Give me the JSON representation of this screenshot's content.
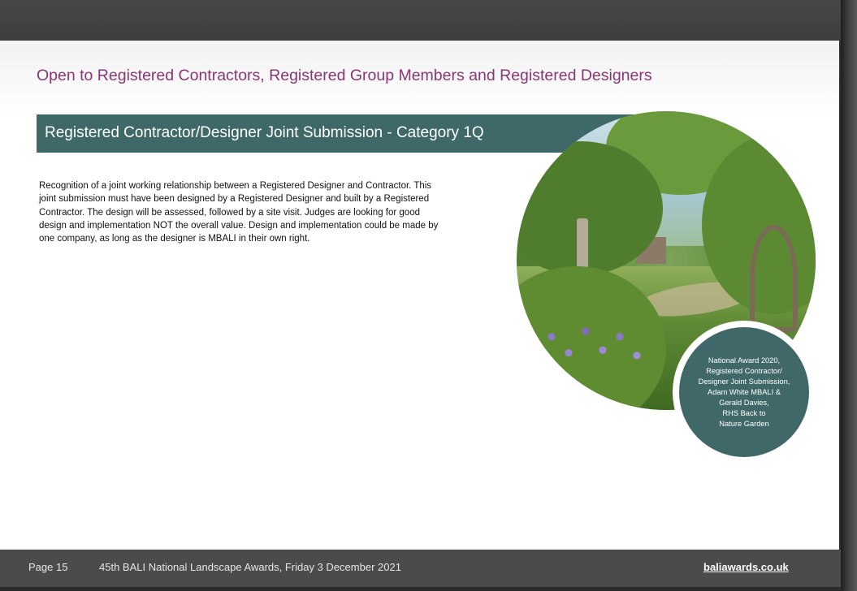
{
  "header": {
    "eligibility": "Open to Registered Contractors, Registered Group Members and Registered Designers"
  },
  "category": {
    "title": "Registered Contractor/Designer Joint Submission - Category 1Q"
  },
  "description": "Recognition of a joint working relationship between a Registered Designer and Contractor. This joint submission must have been designed by a Registered Designer and built by a Registered Contractor. The design will be assessed, followed by a site visit. Judges are looking for good design and implementation NOT the overall value. Design and implementation could be made by one company, as long as the designer is MBALI in their own right.",
  "photo": {
    "caption_lines": [
      "National Award 2020,",
      "Registered Contractor/",
      "Designer Joint Submission,",
      "Adam White MBALI &",
      "Gerald Davies,",
      "RHS Back to",
      "Nature Garden"
    ]
  },
  "footer": {
    "page": "Page 15",
    "event": "45th BALI National Landscape Awards, Friday 3 December 2021",
    "website": "baliawards.co.uk"
  },
  "colors": {
    "headline": "#8a3676",
    "category_bar": "#3f6868",
    "caption_circle": "#416868",
    "footer": "#4b4b4b"
  }
}
